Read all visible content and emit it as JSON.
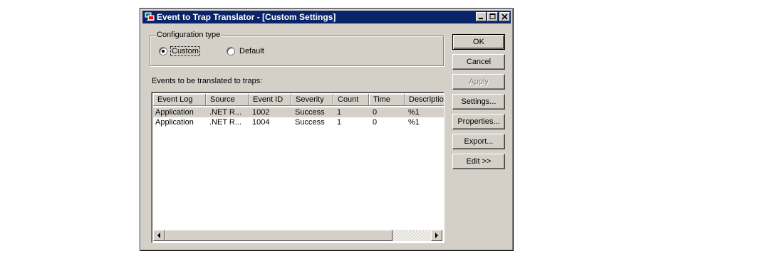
{
  "window": {
    "title": "Event to Trap Translator - [Custom Settings]",
    "titlebar_color": "#0a246a"
  },
  "config": {
    "group_label": "Configuration type",
    "options": [
      {
        "label": "Custom",
        "selected": true
      },
      {
        "label": "Default",
        "selected": false
      }
    ]
  },
  "events_label": "Events to be translated to traps:",
  "table": {
    "columns": [
      "Event Log",
      "Source",
      "Event ID",
      "Severity",
      "Count",
      "Time",
      "Description"
    ],
    "rows": [
      {
        "event_log": "Application",
        "source": ".NET R...",
        "event_id": "1002",
        "severity": "Success",
        "count": "1",
        "time": "0",
        "description": "%1",
        "selected": true
      },
      {
        "event_log": "Application",
        "source": ".NET R...",
        "event_id": "1004",
        "severity": "Success",
        "count": "1",
        "time": "0",
        "description": "%1",
        "selected": false
      }
    ]
  },
  "buttons": {
    "ok": "OK",
    "cancel": "Cancel",
    "apply": "Apply",
    "settings": "Settings...",
    "properties": "Properties...",
    "export": "Export...",
    "edit": "Edit >>"
  },
  "icons": {
    "app": "computer-network-icon",
    "minimize": "minimize-icon",
    "maximize": "maximize-icon",
    "close": "close-icon",
    "scroll_left": "arrow-left-icon",
    "scroll_right": "arrow-right-icon"
  }
}
